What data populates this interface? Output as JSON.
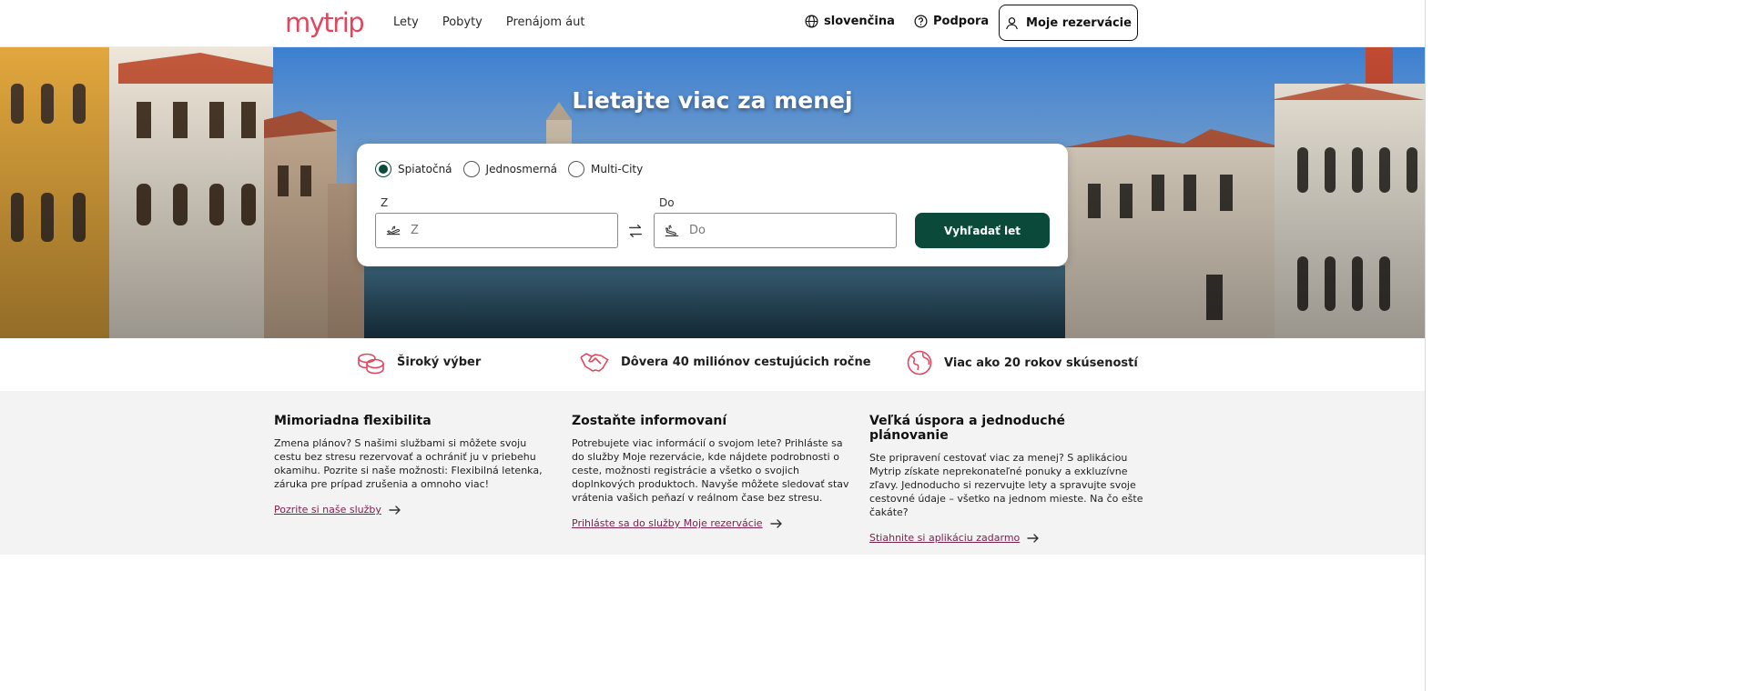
{
  "header": {
    "logo": "mytrip",
    "nav": [
      "Lety",
      "Pobyty",
      "Prenájom áut"
    ],
    "language": "slovenčina",
    "support": "Podpora",
    "reservations": "Moje rezervácie"
  },
  "hero": {
    "title": "Lietajte viac za menej"
  },
  "search": {
    "trip_types": [
      "Spiatočná",
      "Jednosmerná",
      "Multi-City"
    ],
    "selected_trip_type": "Spiatočná",
    "from_label": "Z",
    "from_placeholder": "Z",
    "to_label": "Do",
    "to_placeholder": "Do",
    "submit": "Vyhľadať let",
    "colors": {
      "primary": "#0b4a3a"
    }
  },
  "usp": [
    {
      "icon": "coins-icon",
      "text": "Široký výber"
    },
    {
      "icon": "handshake-icon",
      "text": "Dôvera 40 miliónov cestujúcich ročne"
    },
    {
      "icon": "globe-icon",
      "text": "Viac ako 20 rokov skúseností"
    }
  ],
  "info": [
    {
      "title": "Mimoriadna flexibilita",
      "body": "Zmena plánov? S našimi službami si môžete svoju cestu bez stresu rezervovať a ochrániť ju v priebehu okamihu. Pozrite si naše možnosti: Flexibilná letenka, záruka pre prípad zrušenia a omnoho viac!",
      "link": "Pozrite si naše služby"
    },
    {
      "title": "Zostaňte informovaní",
      "body": "Potrebujete viac informácií o svojom lete? Prihláste sa do služby Moje rezervácie, kde nájdete podrobnosti o ceste, možnosti registrácie a všetko o svojich doplnkových produktoch. Navyše môžete sledovať stav vrátenia vašich peňazí v reálnom čase bez stresu.",
      "link": "Prihláste sa do služby Moje rezervácie"
    },
    {
      "title": "Veľká úspora a jednoduché plánovanie",
      "body": "Ste pripravení cestovať viac za menej? S aplikáciou Mytrip získate neprekonateľné ponuky a exkluzívne zľavy. Jednoducho si rezervujte lety a spravujte svoje cestovné údaje – všetko na jednom mieste. Na čo ešte čakáte?",
      "link": "Stiahnite si aplikáciu zadarmo"
    }
  ],
  "theme": {
    "brand": "#e0475f",
    "link": "#7b1e4a"
  }
}
